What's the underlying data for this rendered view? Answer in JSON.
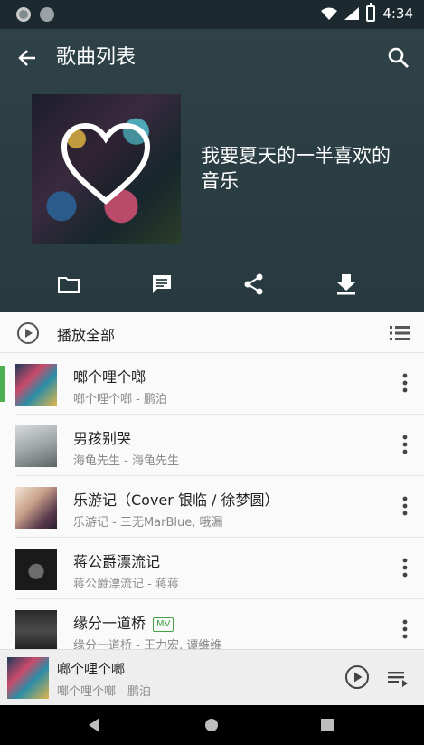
{
  "status_bar": {
    "time": "4:34"
  },
  "toolbar": {
    "title": "歌曲列表"
  },
  "playlist": {
    "name": "我要夏天的一半喜欢的音乐"
  },
  "play_all": {
    "label": "播放全部"
  },
  "songs": [
    {
      "title": "啷个哩个啷",
      "subtitle": "啷个哩个啷 - 鹏泊",
      "active": true,
      "mv": ""
    },
    {
      "title": "男孩别哭",
      "subtitle": "海龟先生 - 海龟先生",
      "active": false,
      "mv": ""
    },
    {
      "title": "乐游记（Cover 银临 / 徐梦圆）",
      "subtitle": "乐游记 - 三无MarBlue, 哦漏",
      "active": false,
      "mv": ""
    },
    {
      "title": "蒋公爵漂流记",
      "subtitle": "蒋公爵漂流记 - 蒋蒋",
      "active": false,
      "mv": ""
    },
    {
      "title": "缘分一道桥",
      "subtitle": "缘分一道桥 - 王力宏, 谭维维",
      "active": false,
      "mv": "MV"
    }
  ],
  "now_playing": {
    "title": "啷个哩个啷",
    "subtitle": "啷个哩个啷 - 鹏泊"
  },
  "colors": {
    "header_bg": "#2e4247",
    "accent": "#4caf50"
  },
  "icons": [
    "back-arrow-icon",
    "search-icon",
    "folder-icon",
    "comment-icon",
    "share-icon",
    "download-icon",
    "play-circle-icon",
    "list-icon",
    "more-vert-icon",
    "queue-icon"
  ]
}
